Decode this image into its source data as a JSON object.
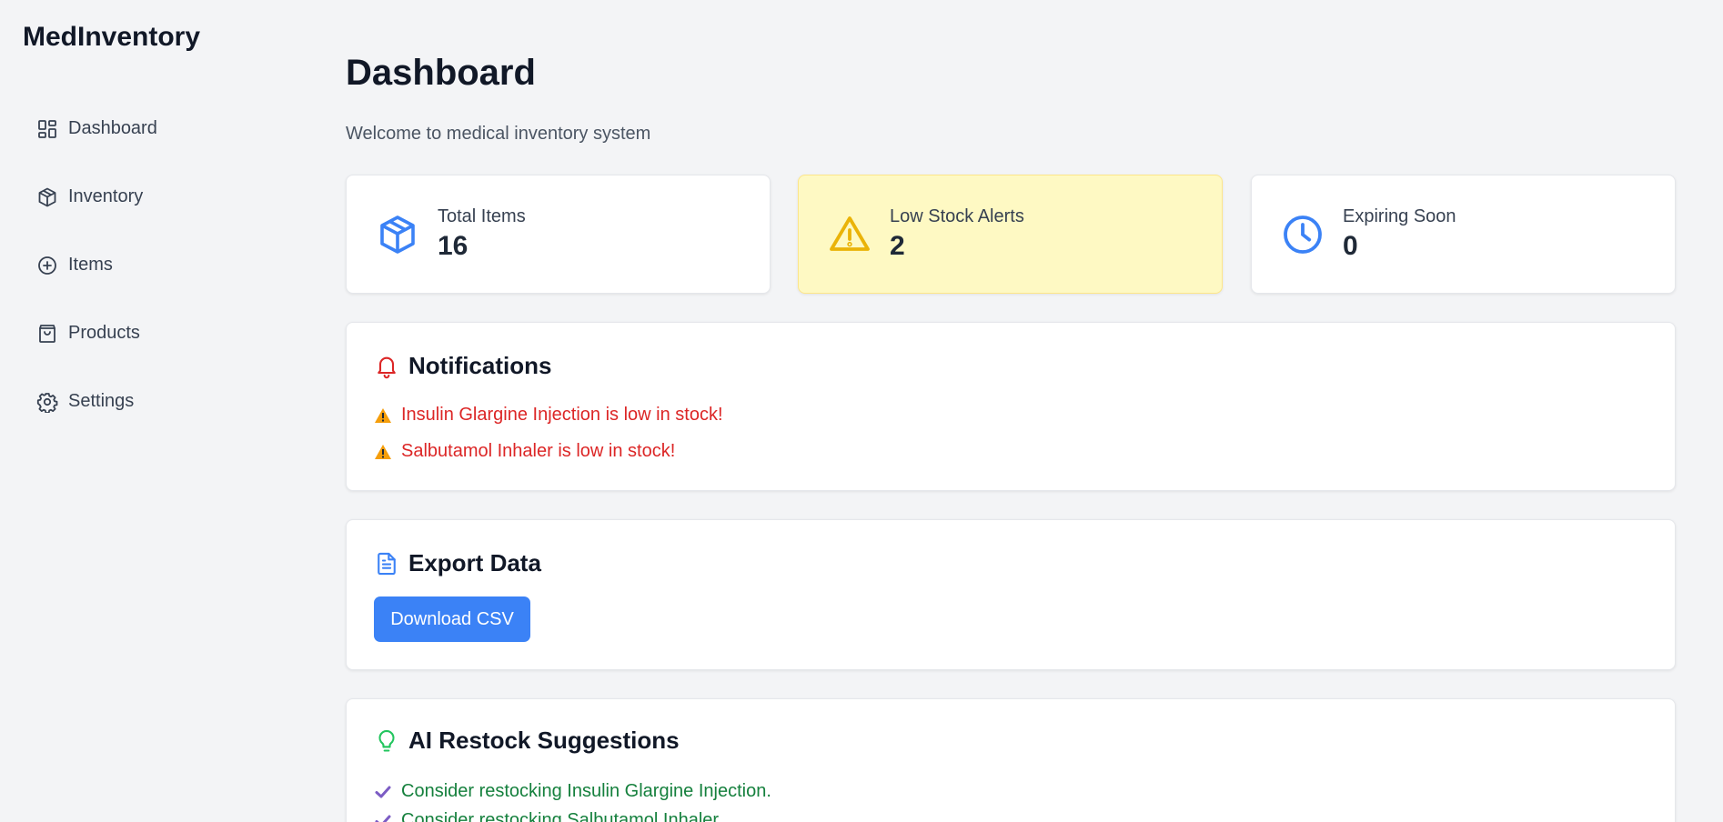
{
  "app": {
    "title": "MedInventory"
  },
  "sidebar": {
    "items": [
      {
        "label": "Dashboard",
        "icon": "dashboard-icon"
      },
      {
        "label": "Inventory",
        "icon": "package-icon"
      },
      {
        "label": "Items",
        "icon": "plus-circle-icon"
      },
      {
        "label": "Products",
        "icon": "shopping-bag-icon"
      },
      {
        "label": "Settings",
        "icon": "gear-icon"
      }
    ]
  },
  "page": {
    "title": "Dashboard",
    "subtitle": "Welcome to medical inventory system"
  },
  "stats": [
    {
      "label": "Total Items",
      "value": "16",
      "icon": "package-icon",
      "color": "#3b82f6"
    },
    {
      "label": "Low Stock Alerts",
      "value": "2",
      "icon": "warning-triangle-icon",
      "color": "#eab308"
    },
    {
      "label": "Expiring Soon",
      "value": "0",
      "icon": "clock-icon",
      "color": "#3b82f6"
    }
  ],
  "notifications": {
    "title": "Notifications",
    "icon": "bell-icon",
    "items": [
      "Insulin Glargine Injection is low in stock!",
      "Salbutamol Inhaler is low in stock!"
    ],
    "color": "#dc2626"
  },
  "export": {
    "title": "Export Data",
    "icon": "document-icon",
    "button_label": "Download CSV",
    "button_color": "#3b82f6"
  },
  "ai": {
    "title": "AI Restock Suggestions",
    "icon": "lightbulb-icon",
    "items": [
      "Consider restocking Insulin Glargine Injection.",
      "Consider restocking Salbutamol Inhaler."
    ],
    "color": "#15803d"
  }
}
